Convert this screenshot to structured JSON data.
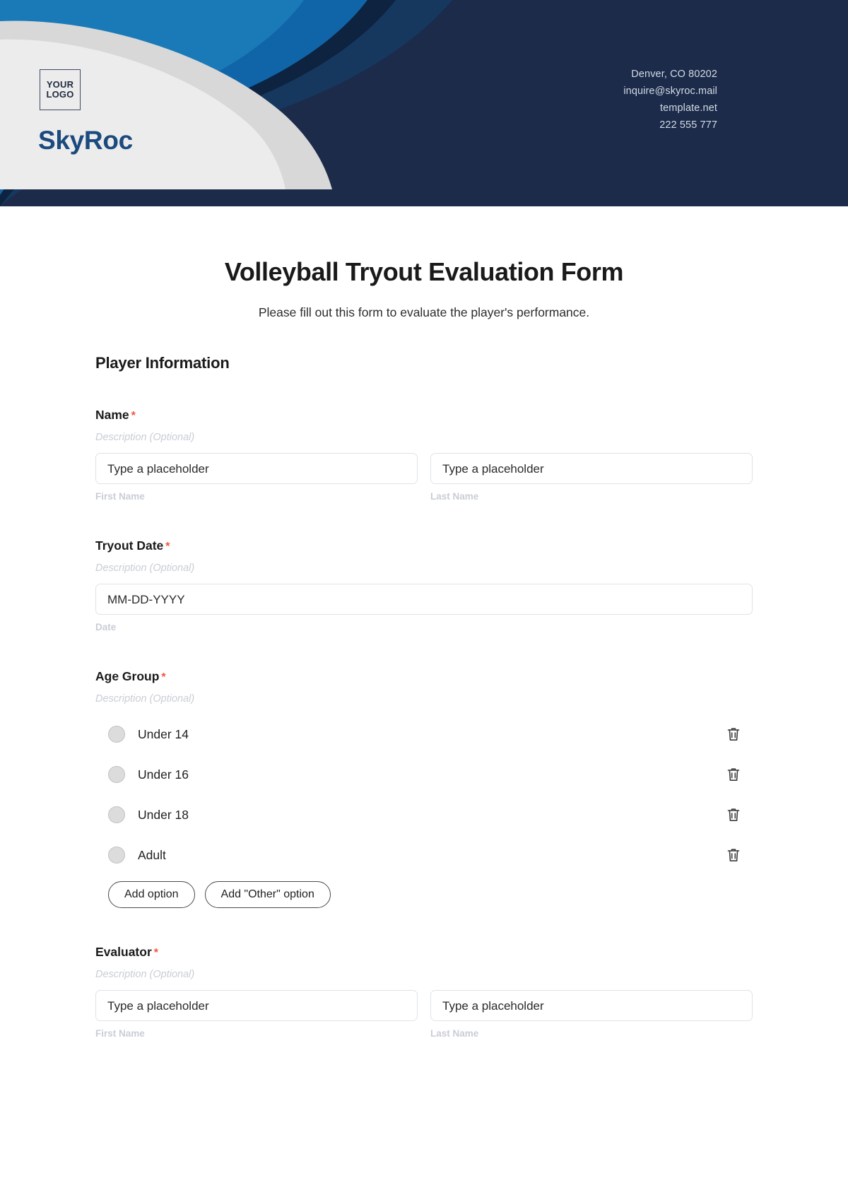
{
  "header": {
    "logo_line1": "YOUR",
    "logo_line2": "LOGO",
    "brand": "SkyRoc",
    "contact": {
      "address": "Denver, CO 80202",
      "email": "inquire@skyroc.mail",
      "website": "template.net",
      "phone": "222 555 777"
    },
    "colors": {
      "dark_navy": "#1c2b4a",
      "mid_navy": "#1d3557",
      "deep_blue": "#17375e",
      "bright_blue": "#1065a8",
      "light_gray": "#ececec",
      "mid_gray": "#d8d8d8",
      "brand_text": "#1b4a7e"
    }
  },
  "form": {
    "title": "Volleyball Tryout Evaluation Form",
    "subtitle": "Please fill out this form to evaluate the player's performance.",
    "section_title": "Player Information",
    "required_mark": "*",
    "description_placeholder": "Description (Optional)",
    "fields": {
      "name": {
        "label": "Name",
        "description": "Description (Optional)",
        "first_placeholder": "Type a placeholder",
        "last_placeholder": "Type a placeholder",
        "first_sub_label": "First Name",
        "last_sub_label": "Last Name"
      },
      "tryout_date": {
        "label": "Tryout Date",
        "description": "Description (Optional)",
        "placeholder": "MM-DD-YYYY",
        "sub_label": "Date"
      },
      "age_group": {
        "label": "Age Group",
        "description": "Description (Optional)",
        "options": [
          {
            "label": "Under 14"
          },
          {
            "label": "Under 16"
          },
          {
            "label": "Under 18"
          },
          {
            "label": "Adult"
          }
        ],
        "add_option_label": "Add option",
        "add_other_option_label": "Add \"Other\" option"
      },
      "evaluator": {
        "label": "Evaluator",
        "description": "Description (Optional)",
        "first_placeholder": "Type a placeholder",
        "last_placeholder": "Type a placeholder",
        "first_sub_label": "First Name",
        "last_sub_label": "Last Name"
      }
    }
  }
}
